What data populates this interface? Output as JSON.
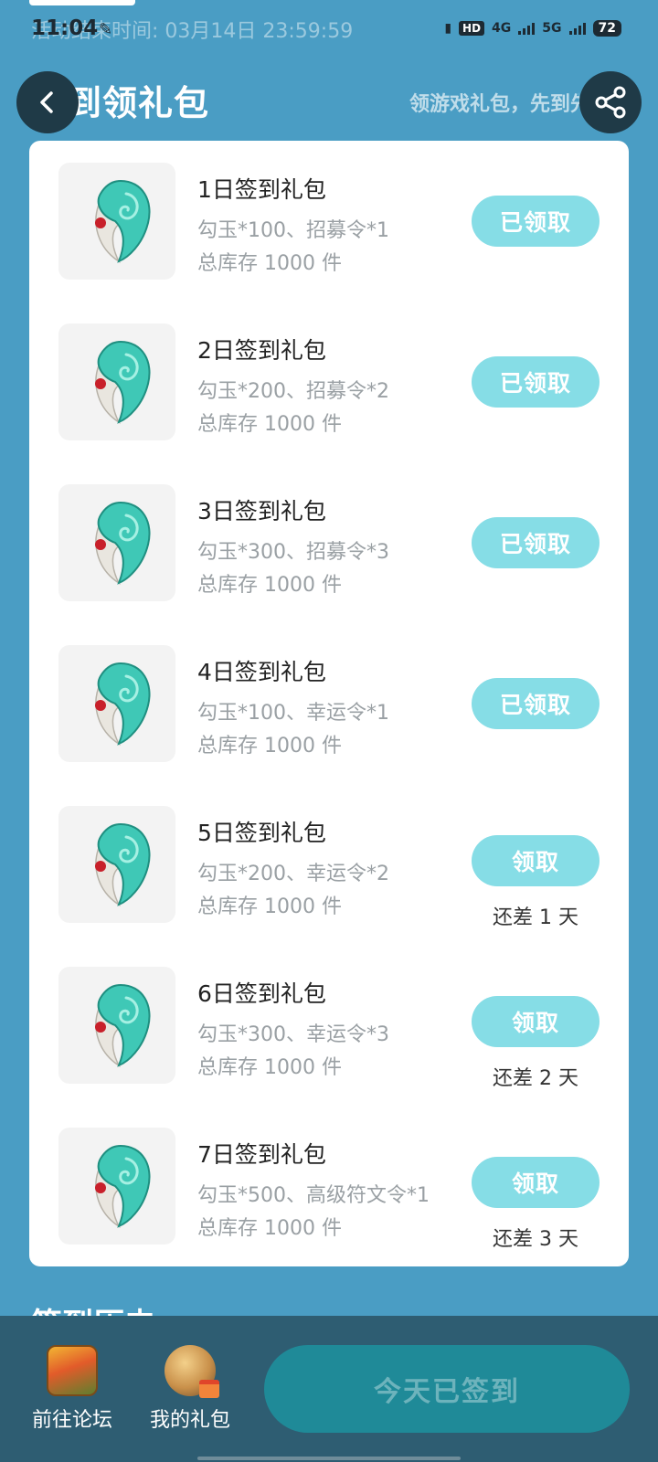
{
  "status_bar": {
    "time": "11:04",
    "activity_end": "活动结束时间: 03月14日 23:59:59",
    "hd_badge": "HD",
    "net_4g": "4G",
    "net_5g": "5G",
    "battery": "72"
  },
  "header": {
    "title": "签到领礼包",
    "marquee": "领游戏礼包，先到先得"
  },
  "gifts": [
    {
      "name": "1日签到礼包",
      "content": "勾玉*100、招募令*1",
      "stock": "总库存 1000 件",
      "button": "已领取",
      "remain": ""
    },
    {
      "name": "2日签到礼包",
      "content": "勾玉*200、招募令*2",
      "stock": "总库存 1000 件",
      "button": "已领取",
      "remain": ""
    },
    {
      "name": "3日签到礼包",
      "content": "勾玉*300、招募令*3",
      "stock": "总库存 1000 件",
      "button": "已领取",
      "remain": ""
    },
    {
      "name": "4日签到礼包",
      "content": "勾玉*100、幸运令*1",
      "stock": "总库存 1000 件",
      "button": "已领取",
      "remain": ""
    },
    {
      "name": "5日签到礼包",
      "content": "勾玉*200、幸运令*2",
      "stock": "总库存 1000 件",
      "button": "领取",
      "remain": "还差 1 天"
    },
    {
      "name": "6日签到礼包",
      "content": "勾玉*300、幸运令*3",
      "stock": "总库存 1000 件",
      "button": "领取",
      "remain": "还差 2 天"
    },
    {
      "name": "7日签到礼包",
      "content": "勾玉*500、高级符文令*1",
      "stock": "总库存 1000 件",
      "button": "领取",
      "remain": "还差 3 天"
    }
  ],
  "section_peek": "签到历史",
  "bottom": {
    "forum_label": "前往论坛",
    "my_gifts_label": "我的礼包",
    "checkin_label": "今天已签到"
  },
  "colors": {
    "background": "#4a9dc4",
    "button_light": "#86dde6",
    "bottom_bar": "#2e5d72",
    "checkin_button": "#1f8a98"
  }
}
